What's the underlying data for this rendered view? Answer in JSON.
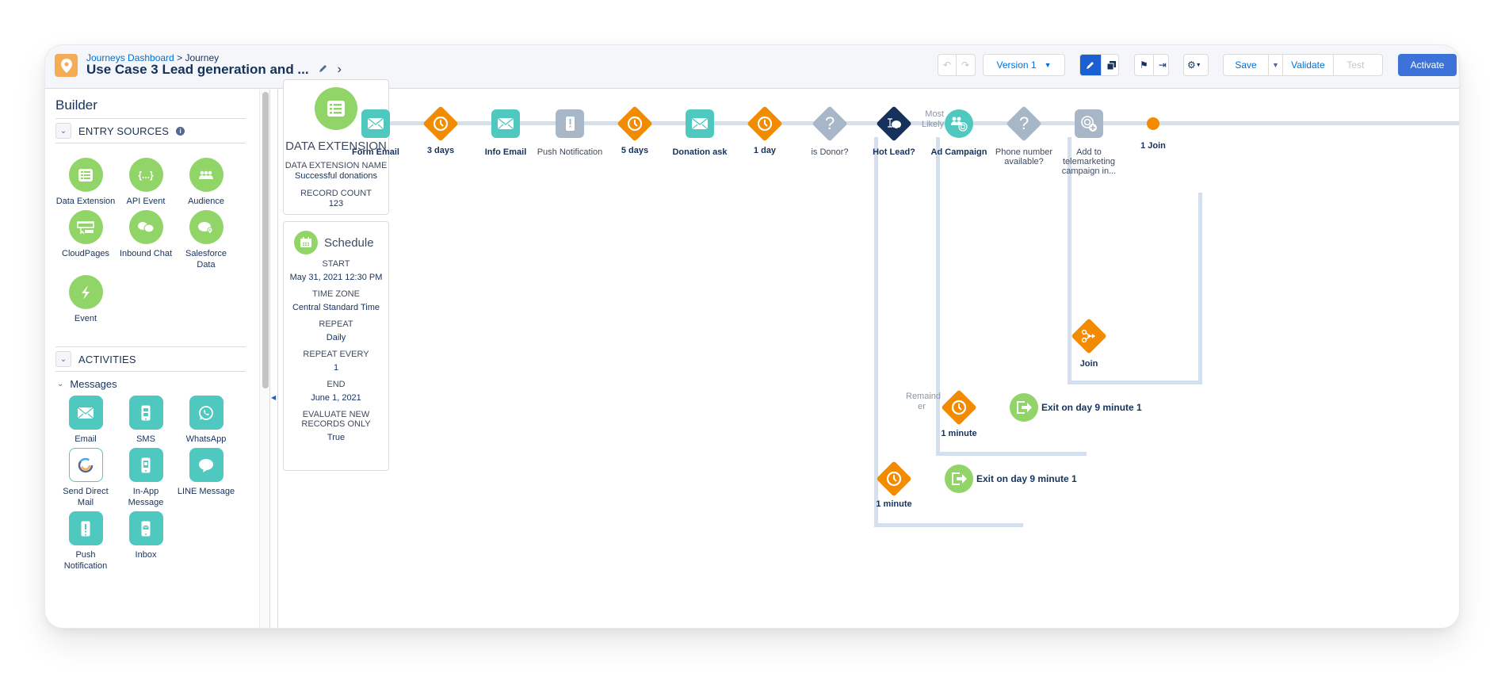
{
  "header": {
    "breadcrumb_link": "Journeys Dashboard",
    "breadcrumb_sep": ">",
    "breadcrumb_current": "Journey",
    "title": "Use Case 3 Lead generation and ...",
    "version_label": "Version 1",
    "save_label": "Save",
    "validate_label": "Validate",
    "test_label": "Test",
    "activate_label": "Activate"
  },
  "sidebar": {
    "title": "Builder",
    "entry_sources_label": "ENTRY SOURCES",
    "entry_sources": [
      {
        "label": "Data Extension",
        "icon": "data-extension-icon"
      },
      {
        "label": "API Event",
        "icon": "api-event-icon"
      },
      {
        "label": "Audience",
        "icon": "audience-icon"
      },
      {
        "label": "CloudPages",
        "icon": "cloudpages-icon"
      },
      {
        "label": "Inbound Chat",
        "icon": "inbound-chat-icon"
      },
      {
        "label": "Salesforce Data",
        "icon": "salesforce-data-icon"
      },
      {
        "label": "Event",
        "icon": "event-icon"
      }
    ],
    "activities_label": "ACTIVITIES",
    "messages_label": "Messages",
    "messages": [
      {
        "label": "Email",
        "icon": "email-icon"
      },
      {
        "label": "SMS",
        "icon": "sms-icon"
      },
      {
        "label": "WhatsApp",
        "icon": "whatsapp-icon"
      },
      {
        "label": "Send Direct Mail",
        "icon": "direct-mail-icon"
      },
      {
        "label": "In-App Message",
        "icon": "in-app-message-icon"
      },
      {
        "label": "LINE Message",
        "icon": "line-message-icon"
      },
      {
        "label": "Push Notification",
        "icon": "push-notification-icon"
      },
      {
        "label": "Inbox",
        "icon": "inbox-icon"
      }
    ]
  },
  "entry_card": {
    "title": "DATA EXTENSION",
    "name_label": "DATA EXTENSION NAME",
    "name_value": "Successful donations",
    "count_label": "RECORD COUNT",
    "count_value": "123"
  },
  "schedule_card": {
    "title": "Schedule",
    "fields": [
      {
        "label": "START",
        "value": "May 31, 2021 12:30 PM"
      },
      {
        "label": "TIME ZONE",
        "value": "Central Standard Time"
      },
      {
        "label": "REPEAT",
        "value": "Daily"
      },
      {
        "label": "REPEAT EVERY",
        "value": "1"
      },
      {
        "label": "END",
        "value": "June 1, 2021"
      },
      {
        "label": "EVALUATE NEW RECORDS ONLY",
        "value": "True"
      }
    ]
  },
  "canvas": {
    "nodes": [
      {
        "label": "Form Email",
        "type": "email"
      },
      {
        "label": "3 days",
        "type": "wait"
      },
      {
        "label": "Info Email",
        "type": "email"
      },
      {
        "label": "Push Notification",
        "type": "push-disabled"
      },
      {
        "label": "5 days",
        "type": "wait"
      },
      {
        "label": "Donation ask",
        "type": "email"
      },
      {
        "label": "1 day",
        "type": "wait"
      },
      {
        "label": "is Donor?",
        "type": "decision-disabled"
      },
      {
        "label": "Hot Lead?",
        "type": "einstein-split"
      },
      {
        "label": "Ad Campaign",
        "type": "ad-audience"
      },
      {
        "label": "Phone number available?",
        "type": "decision-disabled"
      },
      {
        "label": "Add to telemarketing campaign in...",
        "type": "campaign-disabled"
      },
      {
        "label": "1 Join",
        "type": "join-point"
      },
      {
        "label": "Join",
        "type": "join"
      },
      {
        "label": "1 minute",
        "type": "wait"
      },
      {
        "label": "Exit on day 9 minute 1",
        "type": "exit"
      },
      {
        "label": "1 minute",
        "type": "wait"
      },
      {
        "label": "Exit on day 9 minute 1",
        "type": "exit"
      }
    ],
    "path_labels": {
      "most_likely": "Most Likely",
      "remainder": "Remainder"
    }
  },
  "colors": {
    "accent": "#1b5fd0",
    "activate": "#3d73d8",
    "entry_green": "#91d467",
    "message_teal": "#4fc9c0",
    "wait_orange": "#f38b00",
    "disabled_grey": "#a8b7c7",
    "einstein_navy": "#16325c",
    "connector": "#d4e0ee"
  }
}
